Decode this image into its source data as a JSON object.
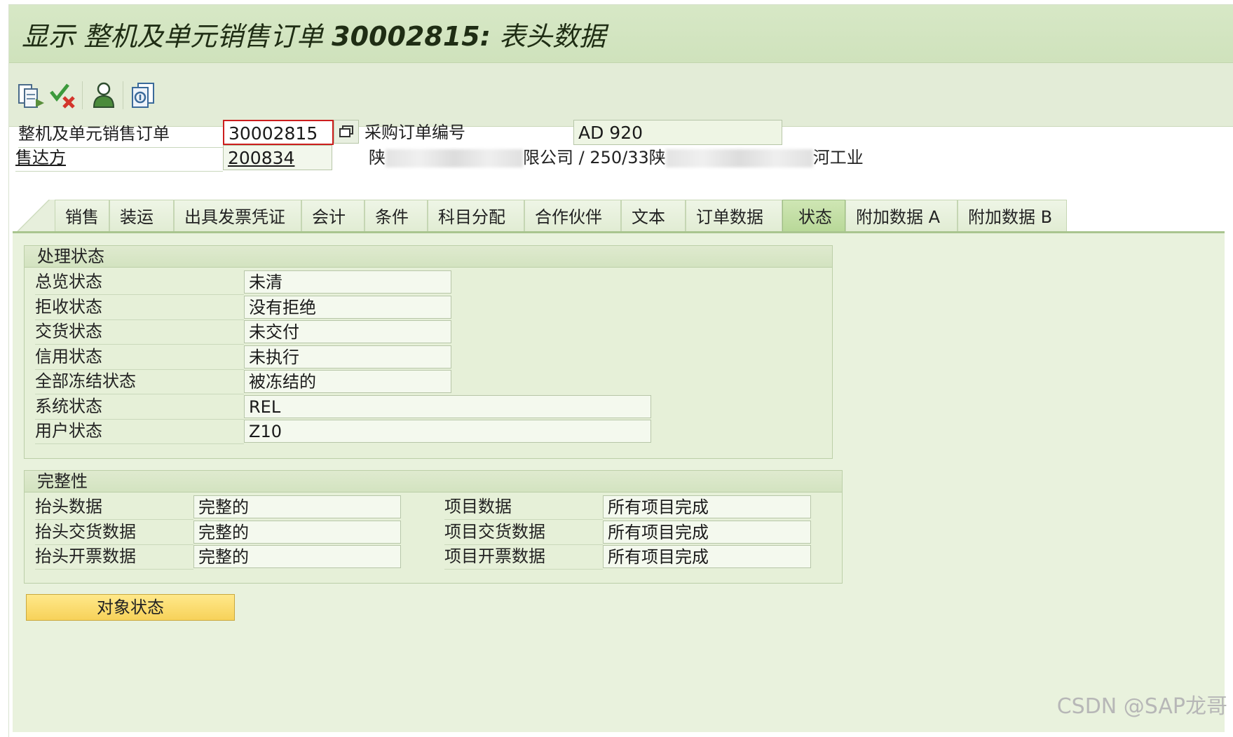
{
  "title": {
    "prefix": "显示 整机及单元销售订单 ",
    "number": "30002815:",
    "suffix": " 表头数据"
  },
  "toolbar": {
    "icons": [
      "display-document-icon",
      "check-cancel-icon",
      "partner-icon",
      "overview-icon"
    ]
  },
  "header": {
    "order_label": "整机及单元销售订单",
    "order_value": "30002815",
    "po_label": "采购订单编号",
    "po_value": "AD 920",
    "soldto_label": "售达方",
    "soldto_value": "200834",
    "soldto_desc_start": "陕",
    "soldto_desc_mid": "限公司 / 250/33陕",
    "soldto_desc_end": "河工业"
  },
  "tabs": [
    "销售",
    "装运",
    "出具发票凭证",
    "会计",
    "条件",
    "科目分配",
    "合作伙伴",
    "文本",
    "订单数据",
    "状态",
    "附加数据 A",
    "附加数据 B"
  ],
  "active_tab": "状态",
  "processing_status": {
    "title": "处理状态",
    "rows": [
      {
        "label": "总览状态",
        "value": "未清"
      },
      {
        "label": "拒收状态",
        "value": "没有拒绝"
      },
      {
        "label": "交货状态",
        "value": "未交付"
      },
      {
        "label": "信用状态",
        "value": "未执行"
      },
      {
        "label": "全部冻结状态",
        "value": "被冻结的"
      },
      {
        "label": "系统状态",
        "value": "REL"
      },
      {
        "label": "用户状态",
        "value": "Z10"
      }
    ]
  },
  "completeness": {
    "title": "完整性",
    "left": [
      {
        "label": "抬头数据",
        "value": "完整的"
      },
      {
        "label": "抬头交货数据",
        "value": "完整的"
      },
      {
        "label": "抬头开票数据",
        "value": "完整的"
      }
    ],
    "right": [
      {
        "label": "项目数据",
        "value": "所有项目完成"
      },
      {
        "label": "项目交货数据",
        "value": "所有项目完成"
      },
      {
        "label": "项目开票数据",
        "value": "所有项目完成"
      }
    ]
  },
  "object_status_button": "对象状态",
  "watermark": "CSDN @SAP龙哥"
}
